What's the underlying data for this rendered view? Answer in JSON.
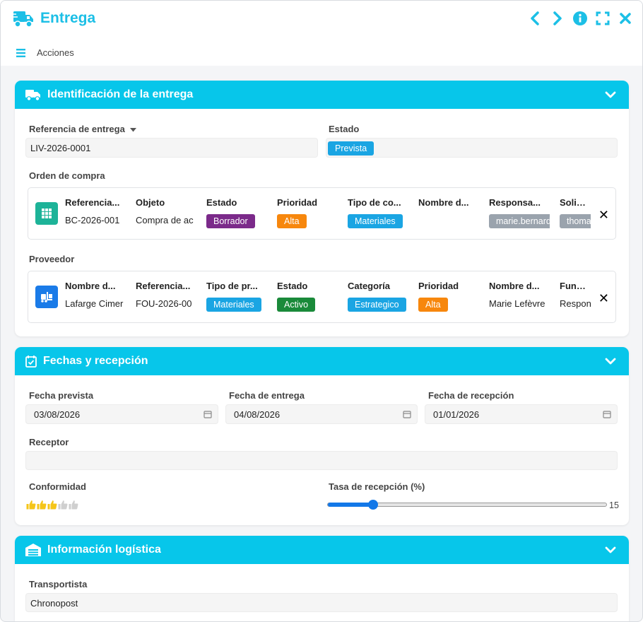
{
  "window": {
    "title": "Entrega"
  },
  "toolbar": {
    "actions_label": "Acciones"
  },
  "colors": {
    "accent": "#07c6ea",
    "header_text": "#1cbfe6"
  },
  "sections": {
    "identification": {
      "title": "Identificación de la entrega",
      "reference_label": "Referencia de entrega",
      "reference_value": "LIV-2026-0001",
      "status_label": "Estado",
      "status_value": "Prevista",
      "po_label": "Orden de compra",
      "po": {
        "columns": [
          {
            "header": "Referencia...",
            "value": "BC-2026-001"
          },
          {
            "header": "Objeto",
            "value": "Compra de ac"
          },
          {
            "header": "Estado",
            "badge": "Borrador",
            "color": "#7b2a8a"
          },
          {
            "header": "Prioridad",
            "badge": "Alta",
            "color": "#f7870d"
          },
          {
            "header": "Tipo de co...",
            "badge": "Materiales",
            "color": "#1aa5e3"
          },
          {
            "header": "Nombre d...",
            "value": ""
          },
          {
            "header": "Responsa...",
            "badge": "marie.bernard",
            "color": "#9aa3ad"
          },
          {
            "header": "Solicitan",
            "badge": "thomas",
            "color": "#9aa3ad"
          }
        ]
      },
      "supplier_label": "Proveedor",
      "supplier": {
        "columns": [
          {
            "header": "Nombre d...",
            "value": "Lafarge Cimer"
          },
          {
            "header": "Referencia...",
            "value": "FOU-2026-00"
          },
          {
            "header": "Tipo de pr...",
            "badge": "Materiales",
            "color": "#1aa5e3"
          },
          {
            "header": "Estado",
            "badge": "Activo",
            "color": "#1a8a3a"
          },
          {
            "header": "Categoría",
            "badge": "Estrategico",
            "color": "#1aa5e3"
          },
          {
            "header": "Prioridad",
            "badge": "Alta",
            "color": "#f7870d"
          },
          {
            "header": "Nombre d...",
            "value": "Marie Lefèvre"
          },
          {
            "header": "Función",
            "value": "Respon"
          }
        ]
      }
    },
    "dates": {
      "title": "Fechas y recepción",
      "planned_label": "Fecha prevista",
      "planned_value": "03/08/2026",
      "delivery_label": "Fecha de entrega",
      "delivery_value": "04/08/2026",
      "reception_label": "Fecha de recepción",
      "reception_value": "01/01/2026",
      "receiver_label": "Receptor",
      "receiver_value": "",
      "conformity_label": "Conformidad",
      "conformity_rating": 3,
      "conformity_max": 5,
      "rate_label": "Tasa de recepción (%)",
      "rate_value": 15
    },
    "logistics": {
      "title": "Información logística",
      "carrier_label": "Transportista",
      "carrier_value": "Chronopost"
    }
  }
}
